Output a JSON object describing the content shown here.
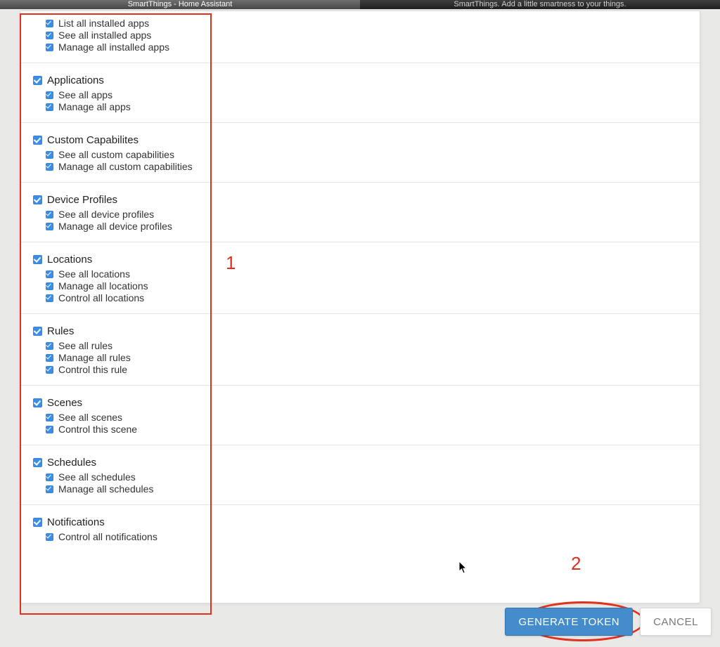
{
  "browser": {
    "tab_active": "SmartThings - Home Assistant",
    "tab_inactive": "SmartThings. Add a little smartness to your things."
  },
  "sections": [
    {
      "name": "installed-apps",
      "items": [
        {
          "label": "List all installed apps"
        },
        {
          "label": "See all installed apps"
        },
        {
          "label": "Manage all installed apps"
        }
      ]
    },
    {
      "name": "applications",
      "title": "Applications",
      "items": [
        {
          "label": "See all apps"
        },
        {
          "label": "Manage all apps"
        }
      ]
    },
    {
      "name": "custom-capabilities",
      "title": "Custom Capabilites",
      "items": [
        {
          "label": "See all custom capabilities"
        },
        {
          "label": "Manage all custom capabilities"
        }
      ]
    },
    {
      "name": "device-profiles",
      "title": "Device Profiles",
      "items": [
        {
          "label": "See all device profiles"
        },
        {
          "label": "Manage all device profiles"
        }
      ]
    },
    {
      "name": "locations",
      "title": "Locations",
      "items": [
        {
          "label": "See all locations"
        },
        {
          "label": "Manage all locations"
        },
        {
          "label": "Control all locations"
        }
      ]
    },
    {
      "name": "rules",
      "title": "Rules",
      "items": [
        {
          "label": "See all rules"
        },
        {
          "label": "Manage all rules"
        },
        {
          "label": "Control this rule"
        }
      ]
    },
    {
      "name": "scenes",
      "title": "Scenes",
      "items": [
        {
          "label": "See all scenes"
        },
        {
          "label": "Control this scene"
        }
      ]
    },
    {
      "name": "schedules",
      "title": "Schedules",
      "items": [
        {
          "label": "See all schedules"
        },
        {
          "label": "Manage all schedules"
        }
      ]
    },
    {
      "name": "notifications",
      "title": "Notifications",
      "items": [
        {
          "label": "Control all notifications"
        }
      ]
    }
  ],
  "actions": {
    "generate": "GENERATE TOKEN",
    "cancel": "CANCEL"
  },
  "annotations": {
    "label1": "1",
    "label2": "2"
  }
}
